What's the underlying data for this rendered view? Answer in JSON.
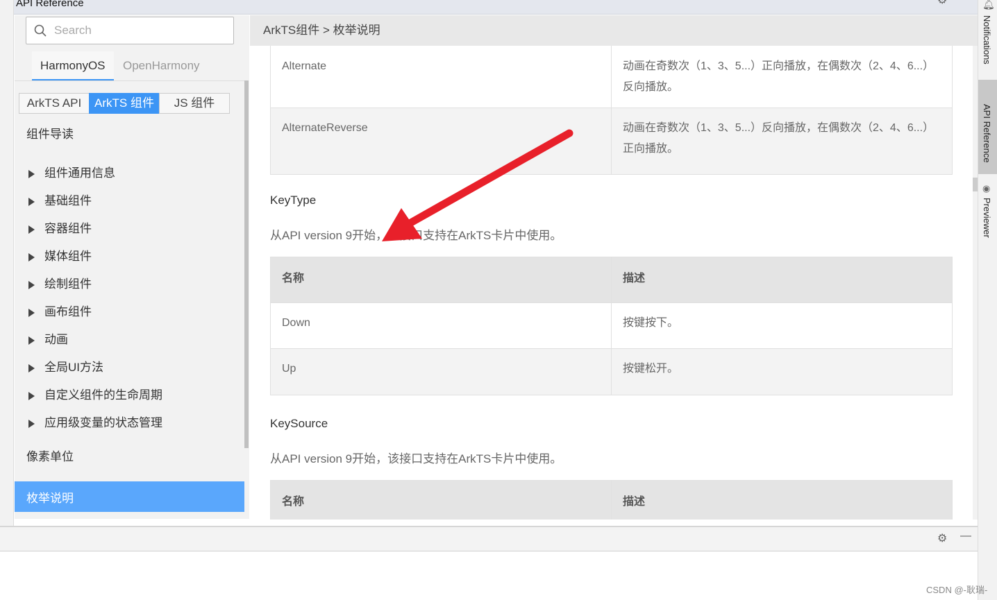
{
  "window": {
    "title": "API Reference"
  },
  "sidebar": {
    "search_placeholder": "Search",
    "os_tabs": [
      {
        "label": "HarmonyOS",
        "active": true
      },
      {
        "label": "OpenHarmony",
        "active": false
      }
    ],
    "segments": [
      {
        "label": "ArkTS API"
      },
      {
        "label": "ArkTS 组件",
        "active": true
      },
      {
        "label": "JS 组件"
      }
    ],
    "intro": "组件导读",
    "groups": [
      "组件通用信息",
      "基础组件",
      "容器组件",
      "媒体组件",
      "绘制组件",
      "画布组件",
      "动画",
      "全局UI方法",
      "自定义组件的生命周期",
      "应用级变量的状态管理"
    ],
    "pixel": "像素单位",
    "active_item": "枚举说明"
  },
  "breadcrumb": "ArkTS组件 > 枚举说明",
  "content": {
    "top_rows": [
      {
        "name": "Alternate",
        "desc": "动画在奇数次（1、3、5...）正向播放，在偶数次（2、4、6...）反向播放。"
      },
      {
        "name": "AlternateReverse",
        "desc": "动画在奇数次（1、3、5...）反向播放，在偶数次（2、4、6...）正向播放。"
      }
    ],
    "keytype": {
      "title": "KeyType",
      "note": "从API version 9开始，该接口支持在ArkTS卡片中使用。",
      "headers": [
        "名称",
        "描述"
      ],
      "rows": [
        {
          "name": "Down",
          "desc": "按键按下。"
        },
        {
          "name": "Up",
          "desc": "按键松开。"
        }
      ]
    },
    "keysource": {
      "title": "KeySource",
      "note": "从API version 9开始，该接口支持在ArkTS卡片中使用。",
      "headers": [
        "名称",
        "描述"
      ]
    }
  },
  "right_tools": [
    "Notifications",
    "API Reference",
    "Previewer"
  ],
  "watermark": "CSDN @-耿瑞-",
  "colors": {
    "accent": "#3c95f5",
    "active_item": "#5aa7fc",
    "arrow": "#e8202a"
  }
}
